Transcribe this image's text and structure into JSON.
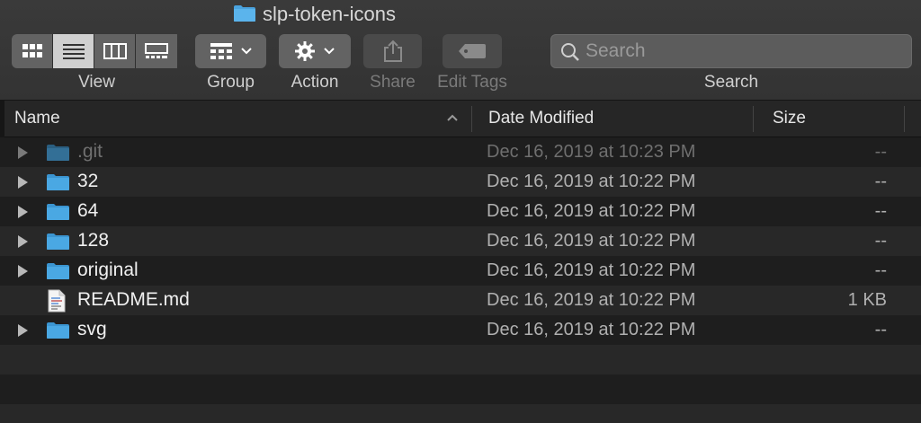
{
  "window": {
    "title": "slp-token-icons",
    "title_icon": "folder-icon"
  },
  "toolbar": {
    "view_label": "View",
    "group_label": "Group",
    "action_label": "Action",
    "share_label": "Share",
    "edit_tags_label": "Edit Tags",
    "search_label": "Search",
    "search_placeholder": "Search",
    "search_value": ""
  },
  "columns": {
    "name": "Name",
    "date": "Date Modified",
    "size": "Size"
  },
  "files": [
    {
      "name": ".git",
      "date": "Dec 16, 2019 at 10:23 PM",
      "size": "--",
      "kind": "folder",
      "dim": true
    },
    {
      "name": "32",
      "date": "Dec 16, 2019 at 10:22 PM",
      "size": "--",
      "kind": "folder"
    },
    {
      "name": "64",
      "date": "Dec 16, 2019 at 10:22 PM",
      "size": "--",
      "kind": "folder"
    },
    {
      "name": "128",
      "date": "Dec 16, 2019 at 10:22 PM",
      "size": "--",
      "kind": "folder"
    },
    {
      "name": "original",
      "date": "Dec 16, 2019 at 10:22 PM",
      "size": "--",
      "kind": "folder"
    },
    {
      "name": "README.md",
      "date": "Dec 16, 2019 at 10:22 PM",
      "size": "1 KB",
      "kind": "document"
    },
    {
      "name": "svg",
      "date": "Dec 16, 2019 at 10:22 PM",
      "size": "--",
      "kind": "folder"
    }
  ],
  "colors": {
    "folder": "#4aa3df",
    "folder_dim": "#2e6a8f",
    "toolbar": "#363636",
    "row_alt": "#282828"
  }
}
